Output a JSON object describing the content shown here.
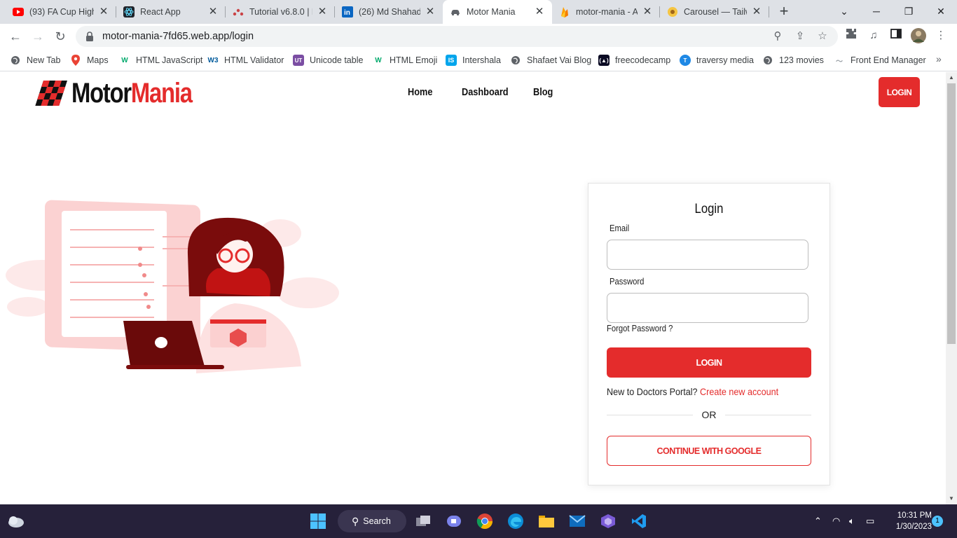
{
  "browser": {
    "tabs": [
      {
        "title": "(93) FA Cup High",
        "icon": "youtube-icon"
      },
      {
        "title": "React App",
        "icon": "react-icon"
      },
      {
        "title": "Tutorial v6.8.0 | R",
        "icon": "react-router-icon"
      },
      {
        "title": "(26) Md Shahada",
        "icon": "linkedin-icon"
      },
      {
        "title": "Motor Mania",
        "icon": "car-icon"
      },
      {
        "title": "motor-mania - A",
        "icon": "firebase-icon"
      },
      {
        "title": "Carousel — Tailw",
        "icon": "daisyui-icon"
      }
    ],
    "url": "motor-mania-7fd65.web.app/login",
    "bookmarks": [
      {
        "label": "New Tab",
        "icon": "globe-icon"
      },
      {
        "label": "Maps",
        "icon": "maps-pin-icon"
      },
      {
        "label": "HTML JavaScript",
        "icon": "w3schools-icon"
      },
      {
        "label": "HTML Validator",
        "icon": "w3c-icon"
      },
      {
        "label": "Unicode table",
        "icon": "unicode-icon"
      },
      {
        "label": "HTML Emoji",
        "icon": "w3schools-icon"
      },
      {
        "label": "Intershala",
        "icon": "internshala-icon"
      },
      {
        "label": "Shafaet Vai Blog",
        "icon": "globe-icon"
      },
      {
        "label": "freecodecamp",
        "icon": "freecodecamp-icon"
      },
      {
        "label": "traversy media",
        "icon": "traversy-icon"
      },
      {
        "label": "123 movies",
        "icon": "globe-icon"
      },
      {
        "label": "Front End Manager",
        "icon": "fem-icon"
      }
    ]
  },
  "site": {
    "logo_motor": "Motor",
    "logo_mania": "Mania",
    "nav": [
      "Home",
      "Dashboard",
      "Blog"
    ],
    "login_button": "LOGIN"
  },
  "login_form": {
    "title": "Login",
    "email_label": "Email",
    "email_value": "",
    "password_label": "Password",
    "password_value": "",
    "forgot": "Forgot Password ?",
    "submit": "LOGIN",
    "new_to": "New to Doctors Portal?",
    "create_account": "Create new account",
    "or": "OR",
    "google": "CONTINUE WITH GOOGLE"
  },
  "taskbar": {
    "search": "Search",
    "time": "10:31 PM",
    "date": "1/30/2023",
    "notifications": "1"
  },
  "colors": {
    "accent": "#e42c2c",
    "taskbar": "#26213a"
  }
}
